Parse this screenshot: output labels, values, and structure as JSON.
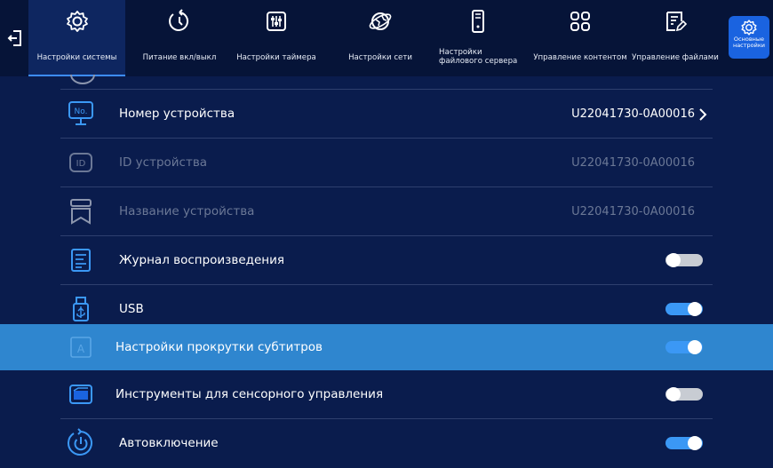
{
  "nav": {
    "tabs": [
      {
        "label": "Настройки системы",
        "icon": "gear-icon",
        "active": true
      },
      {
        "label": "Питание вкл/выкл",
        "icon": "power-timer-icon"
      },
      {
        "label": "Настройки таймера",
        "icon": "timer-settings-icon"
      },
      {
        "label": "Настройки сети",
        "icon": "network-globe-icon"
      },
      {
        "label": "Настройки файлового сервера",
        "icon": "file-server-icon"
      },
      {
        "label": "Управление контентом",
        "icon": "grid-content-icon"
      },
      {
        "label": "Управление файлами",
        "icon": "file-edit-icon"
      }
    ],
    "corner_button": {
      "label": "Основные настройки",
      "icon": "gear-icon"
    }
  },
  "rows": [
    {
      "label": "Номер устройства",
      "value": "U22041730-0A00016",
      "icon": "device-number-icon",
      "has_chevron": true,
      "dim": false
    },
    {
      "label": "ID устройства",
      "value": "U22041730-0A00016",
      "icon": "id-icon",
      "dim": true
    },
    {
      "label": "Название устройства",
      "value": "U22041730-0A00016",
      "icon": "device-name-icon",
      "dim": true
    },
    {
      "label": "Журнал воспроизведения",
      "icon": "playback-log-icon",
      "toggle": false
    },
    {
      "label": "USB",
      "icon": "usb-icon",
      "toggle": true
    },
    {
      "label": "Настройки прокрутки субтитров",
      "icon": "subtitle-scroll-icon",
      "toggle": true,
      "highlighted": true
    },
    {
      "label": "Инструменты для сенсорного управления",
      "icon": "touch-tools-icon",
      "toggle": false
    },
    {
      "label": "Автовключение",
      "icon": "auto-power-icon",
      "toggle": true
    }
  ],
  "colors": {
    "background": "#0a1c4d",
    "header": "#061438",
    "highlight": "#2f86cf",
    "toggle_on": "#3b98f5",
    "toggle_off": "#c8ccd3",
    "accent": "#1a63e0"
  }
}
